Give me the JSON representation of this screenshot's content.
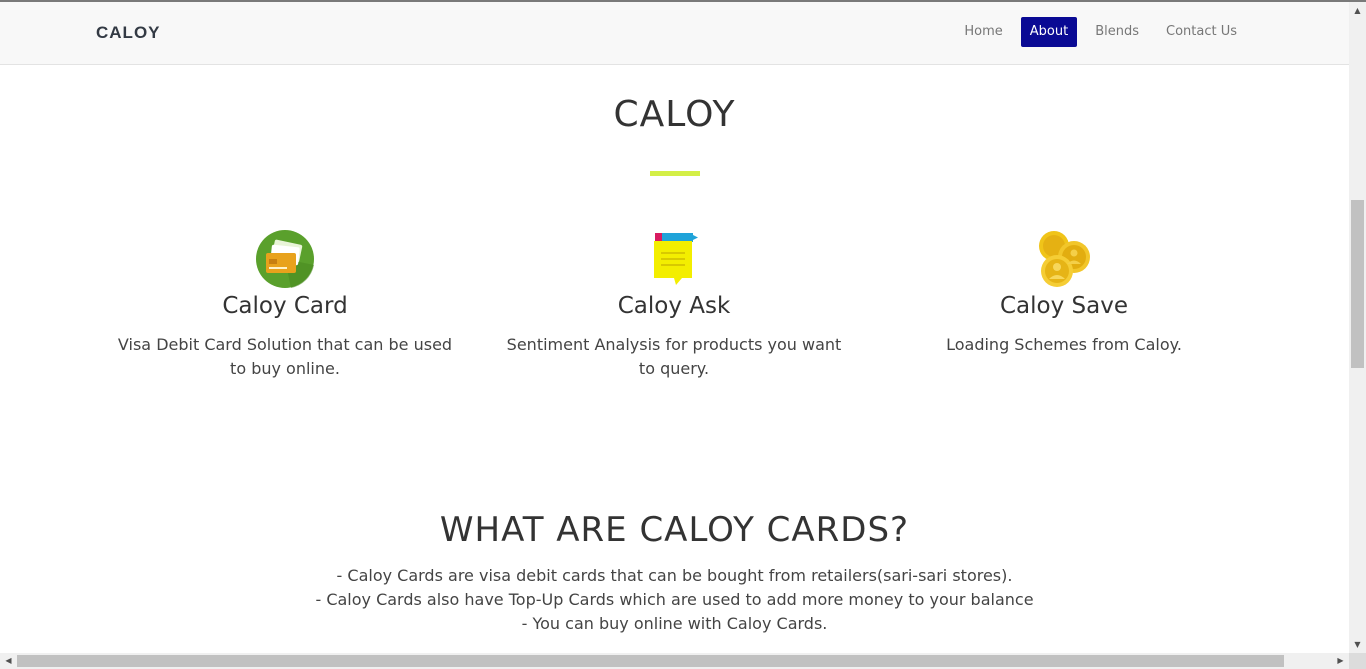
{
  "navbar": {
    "brand": "CALOY",
    "links": [
      {
        "label": "Home",
        "active": false
      },
      {
        "label": "About",
        "active": true
      },
      {
        "label": "Blends",
        "active": false
      },
      {
        "label": "Contact Us",
        "active": false
      }
    ]
  },
  "hero": {
    "title": "CALOY",
    "accent_color": "#d4ef47"
  },
  "features": [
    {
      "icon": "credit-card-icon",
      "title": "Caloy Card",
      "description": "Visa Debit Card Solution that can be used to buy online."
    },
    {
      "icon": "chat-note-icon",
      "title": "Caloy Ask",
      "description": "Sentiment Analysis for products you want to query."
    },
    {
      "icon": "coins-icon",
      "title": "Caloy Save",
      "description": "Loading Schemes from Caloy."
    }
  ],
  "cards_section": {
    "title": "WHAT ARE CALOY CARDS?",
    "lines": [
      "- Caloy Cards are visa debit cards that can be bought from retailers(sari-sari stores).",
      "- Caloy Cards also have Top-Up Cards which are used to add more money to your balance",
      "- You can buy online with Caloy Cards."
    ]
  },
  "colors": {
    "active_nav": "#0a0a94",
    "navbar_bg": "#f8f8f8"
  }
}
